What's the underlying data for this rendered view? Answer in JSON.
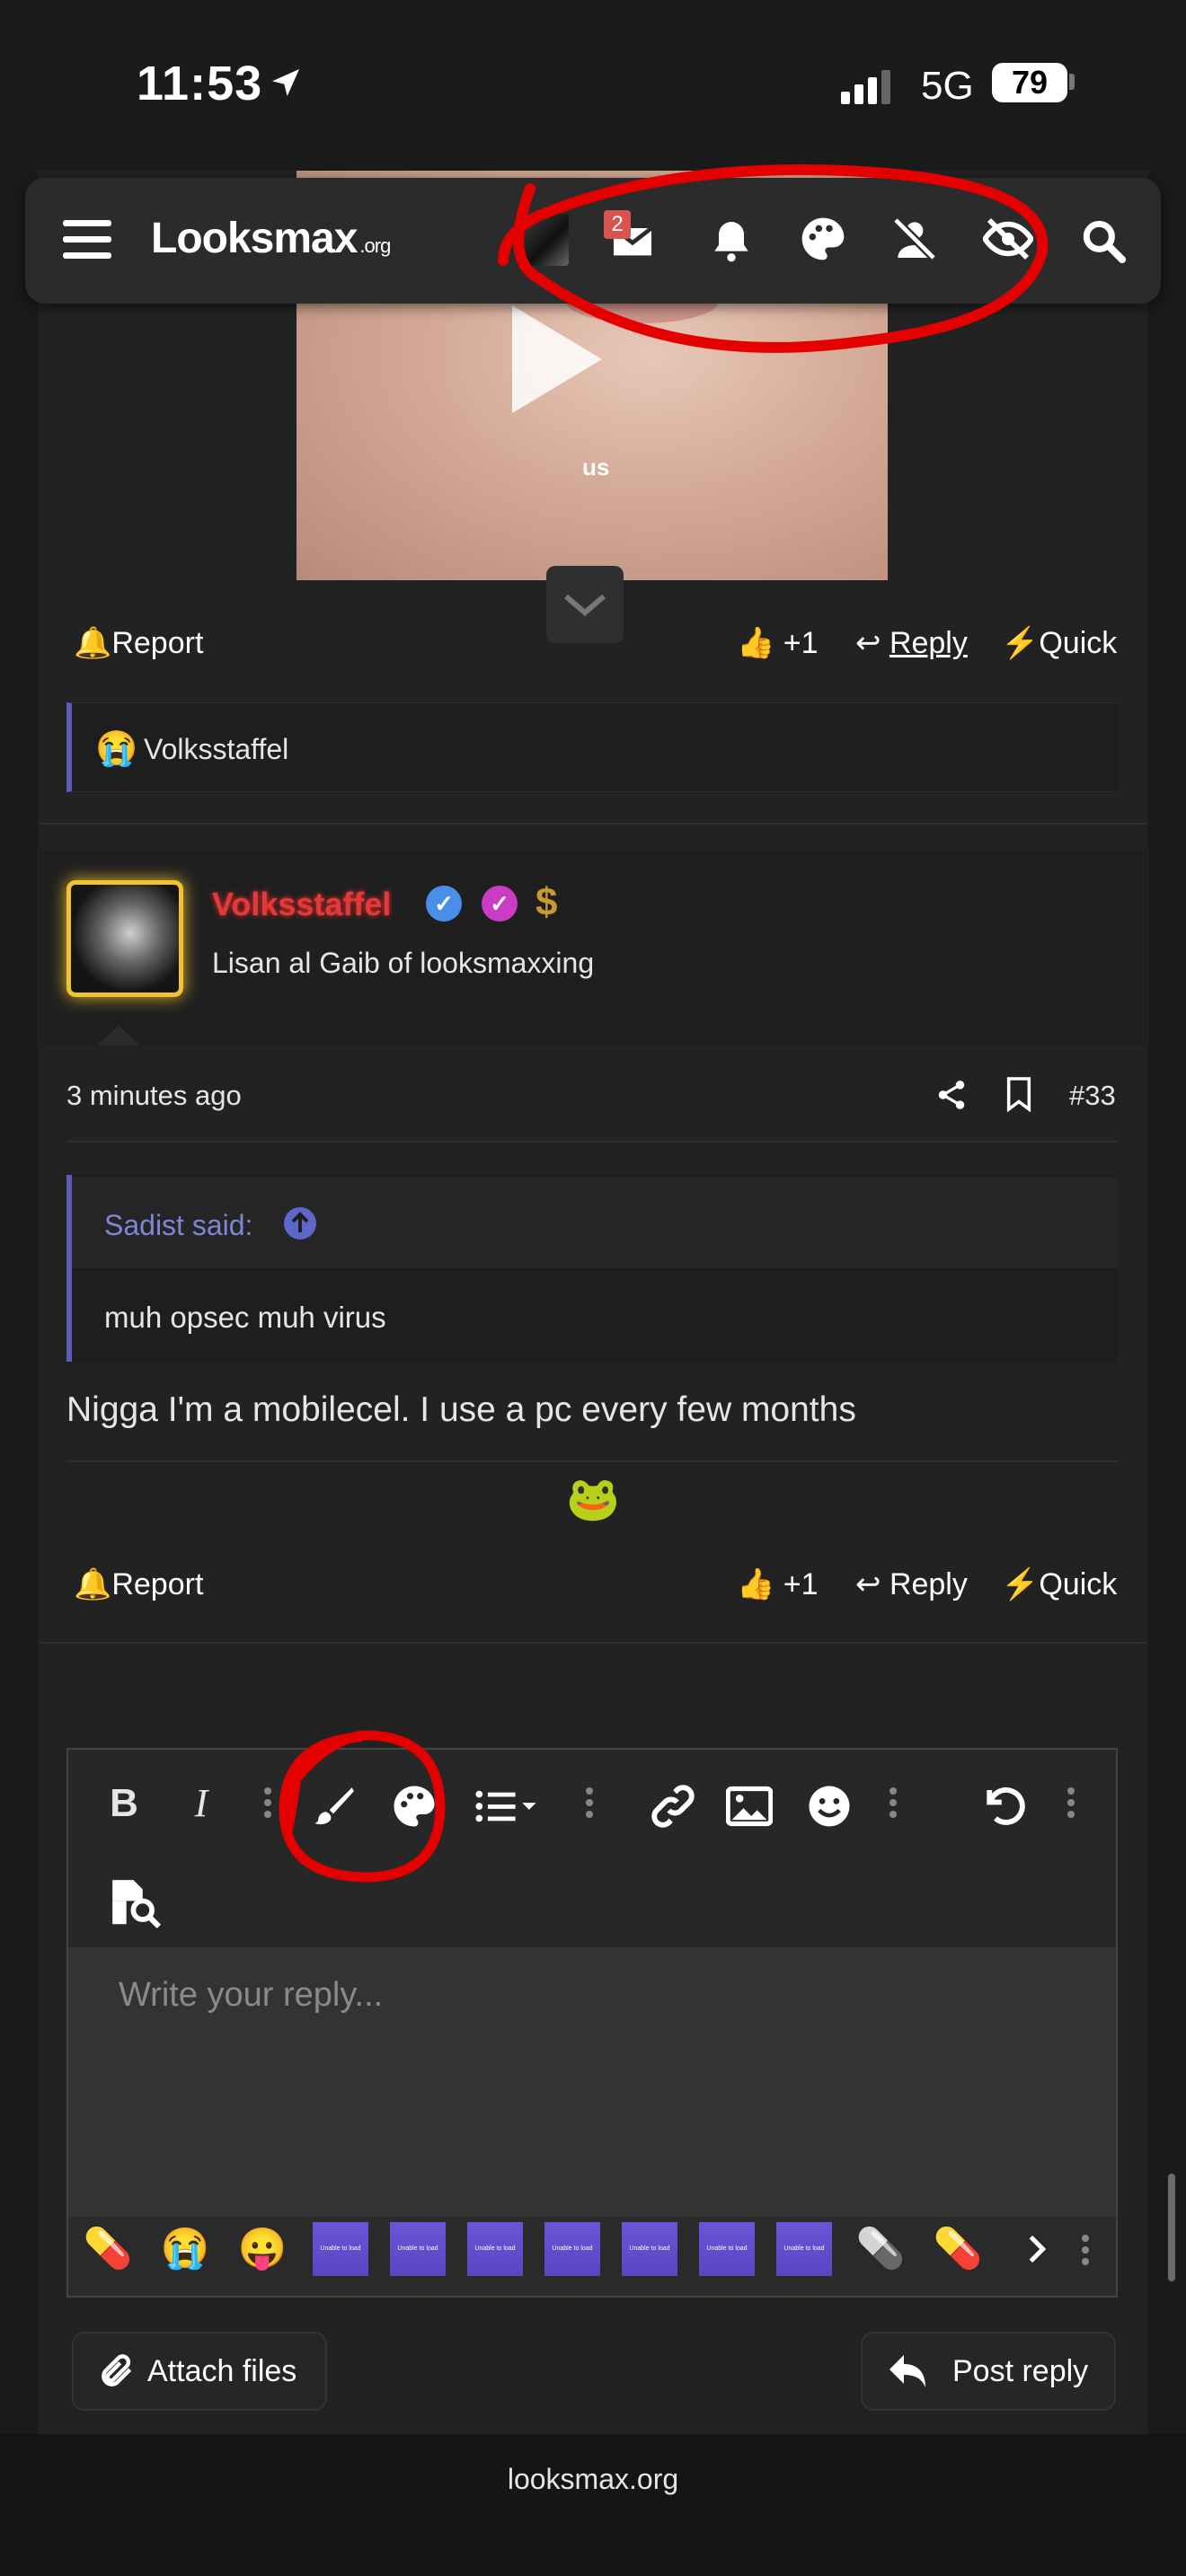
{
  "status": {
    "time": "11:53",
    "network": "5G",
    "battery": "79"
  },
  "nav": {
    "logo": "Looksmax",
    "logo_suffix": ".org",
    "inbox_badge": "2"
  },
  "video": {
    "caption": "us"
  },
  "post_actions": {
    "report": "Report",
    "like": "+1",
    "reply": "Reply",
    "quick": "Quick"
  },
  "reactions": {
    "emoji": "😭",
    "user": "Volksstaffel"
  },
  "post": {
    "username": "Volksstaffel",
    "user_title": "Lisan al Gaib of looksmaxxing",
    "timestamp": "3 minutes ago",
    "number": "#33",
    "quote_author": "Sadist said:",
    "quote_text": "muh opsec muh virus",
    "body": "Nigga I'm a mobilecel. I use a pc every few months",
    "signature_emoji": "🐸"
  },
  "editor": {
    "placeholder": "Write your reply...",
    "smilies": [
      "💊",
      "😭",
      "😛",
      "💊",
      "💊"
    ],
    "smilie_thumb_text": "Unable to load"
  },
  "buttons": {
    "attach": "Attach files",
    "post_reply": "Post reply"
  },
  "footer": {
    "domain": "looksmax.org"
  },
  "colors": {
    "accent": "#5c5fb8",
    "username": "#e03a3a",
    "annotation": "#e50000"
  }
}
